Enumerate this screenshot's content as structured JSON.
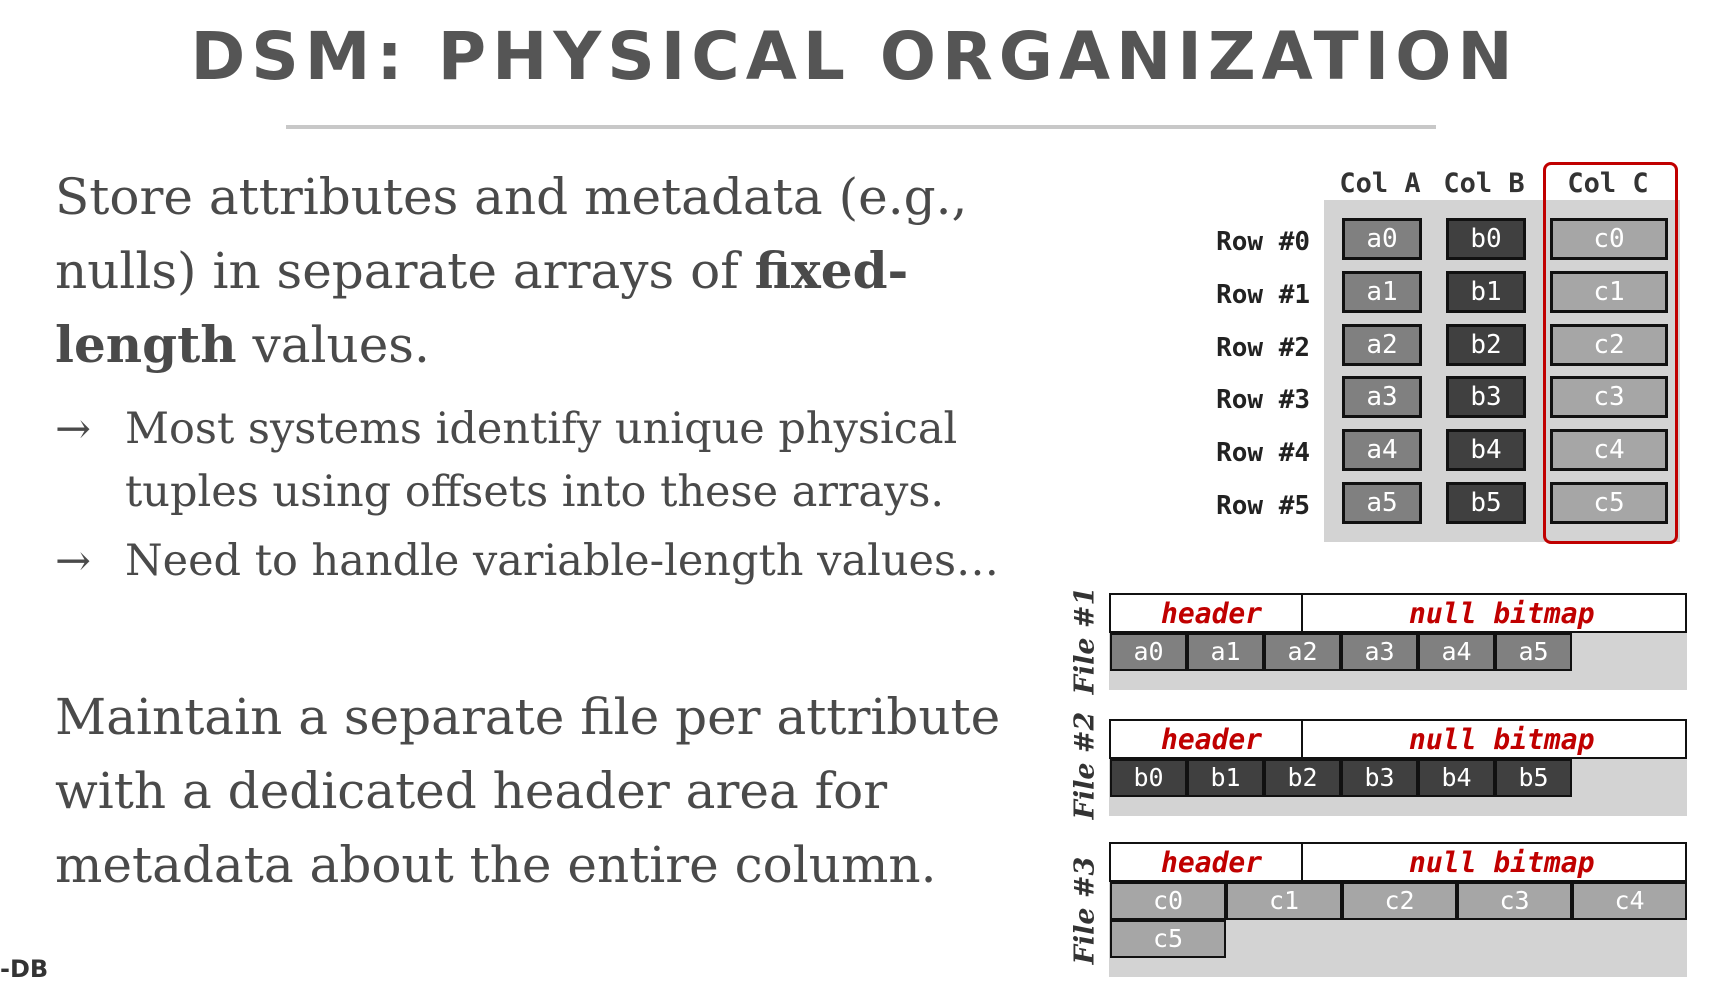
{
  "slide": {
    "title": "DSM: PHYSICAL ORGANIZATION",
    "para1": {
      "before": "Store attributes and metadata (e.g., nulls) in separate arrays of ",
      "bold": "fixed-length",
      "after": " values."
    },
    "bullets": [
      {
        "arrow": "→",
        "text": "Most systems identify unique physical tuples using offsets into these arrays."
      },
      {
        "arrow": "→",
        "text": "Need to handle variable-length values…"
      }
    ],
    "para2": "Maintain a separate file per attribute with a dedicated header area for metadata about the entire column.",
    "logo": "-DB"
  },
  "table": {
    "columns": [
      "Col A",
      "Col B",
      "Col C"
    ],
    "rows": [
      "Row #0",
      "Row #1",
      "Row #2",
      "Row #3",
      "Row #4",
      "Row #5"
    ],
    "col_a": [
      "a0",
      "a1",
      "a2",
      "a3",
      "a4",
      "a5"
    ],
    "col_b": [
      "b0",
      "b1",
      "b2",
      "b3",
      "b4",
      "b5"
    ],
    "col_c": [
      "c0",
      "c1",
      "c2",
      "c3",
      "c4",
      "c5"
    ],
    "highlight_color": "#c00000"
  },
  "files": [
    {
      "label": "File #1",
      "header": "header",
      "bitmap": "null bitmap",
      "values": [
        "a0",
        "a1",
        "a2",
        "a3",
        "a4",
        "a5"
      ]
    },
    {
      "label": "File #2",
      "header": "header",
      "bitmap": "null bitmap",
      "values": [
        "b0",
        "b1",
        "b2",
        "b3",
        "b4",
        "b5"
      ]
    },
    {
      "label": "File #3",
      "header": "header",
      "bitmap": "null bitmap",
      "values": [
        "c0",
        "c1",
        "c2",
        "c3",
        "c4",
        "c5"
      ]
    }
  ]
}
